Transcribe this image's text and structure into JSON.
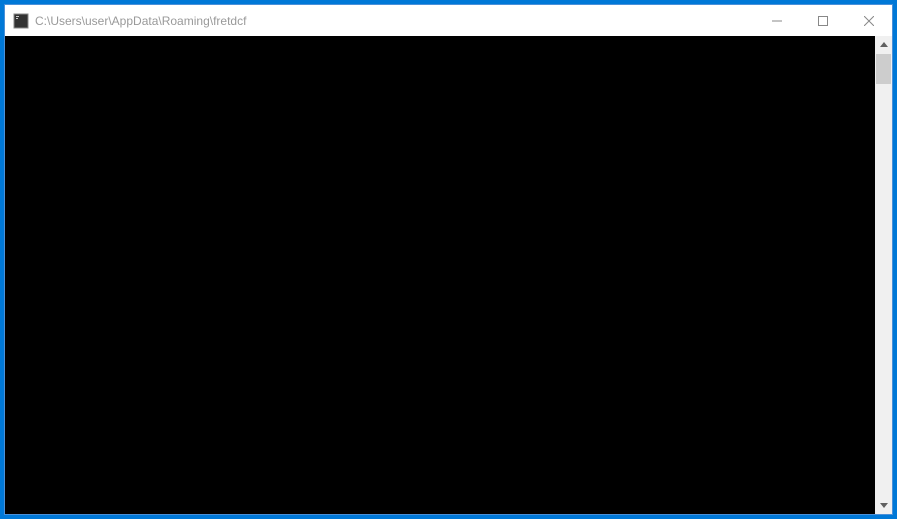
{
  "window": {
    "title": "C:\\Users\\user\\AppData\\Roaming\\fretdcf"
  }
}
